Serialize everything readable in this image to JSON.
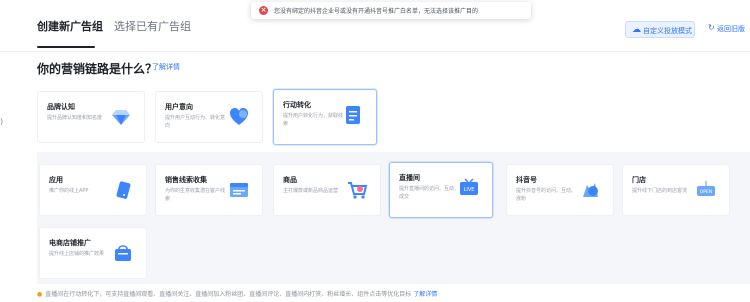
{
  "tabs": [
    {
      "label": "创建新广告组"
    },
    {
      "label": "选择已有广告组"
    }
  ],
  "toast": {
    "text": "您没有绑定的抖音企业号或没有开通抖音号推广白名单，无法选择该推广目的"
  },
  "header_actions": {
    "mode_label": "自定义投放模式",
    "back_label": "返回旧版"
  },
  "section": {
    "heading": "你的营销链路是什么？",
    "learn_more": "了解详情"
  },
  "left_marker": ")",
  "funnel_cards": [
    {
      "title": "品牌认知",
      "desc": "提升品牌认知度和知名度"
    },
    {
      "title": "用户意向",
      "desc": "提升用户互动行为、转化意向"
    },
    {
      "title": "行动转化",
      "desc": "提升用户转化行为，获取线索"
    }
  ],
  "goal_cards": [
    {
      "title": "应用",
      "desc": "推广你的线上APP"
    },
    {
      "title": "销售线索收集",
      "desc": "为你的生意收集潜在客户线索"
    },
    {
      "title": "商品",
      "desc": "主打爆款或新品商品运营"
    },
    {
      "title": "直播间",
      "desc": "提升直播间的访问、互动、成交"
    },
    {
      "title": "抖音号",
      "desc": "提升抖音号的访问、互动、涨粉"
    },
    {
      "title": "门店",
      "desc": "提升线下门店的到店客流"
    },
    {
      "title": "电商店铺推广",
      "desc": "提升线上店铺的推广效果"
    }
  ],
  "footer": {
    "text": "直播间在行动转化下，可支持直播间观看、直播间关注、直播间加入粉丝团、直播间评论、直播间内打赏、粉丝增长、组件点击等优化目标",
    "link": "了解详情"
  },
  "colors": {
    "accent": "#2f73ff",
    "error": "#e54545",
    "card_border_selected": "#9dc0ff"
  }
}
